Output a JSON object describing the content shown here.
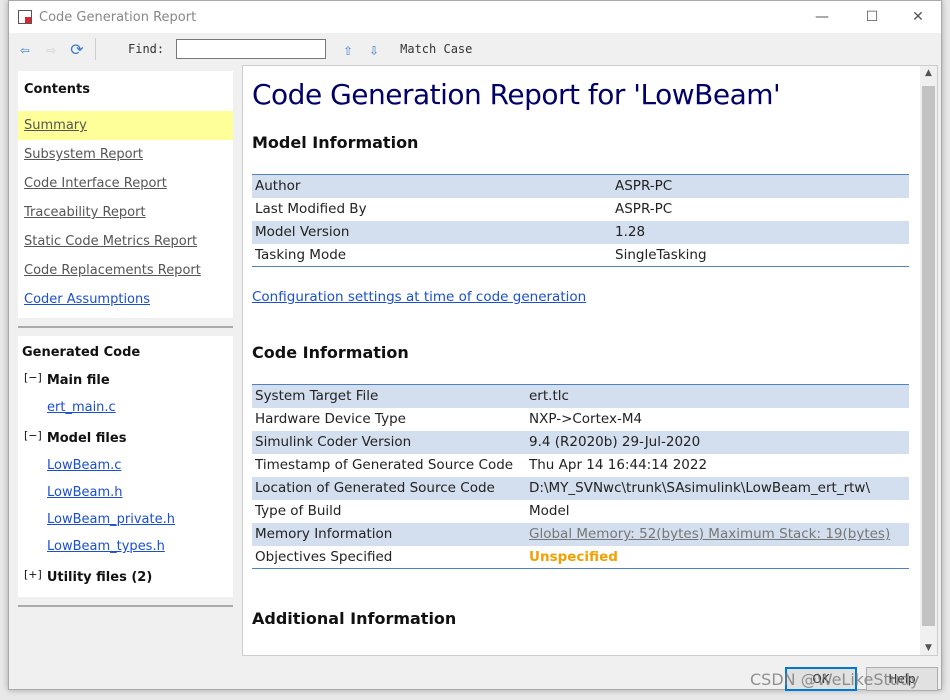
{
  "window": {
    "title": "Code Generation Report",
    "minimize": "—",
    "maximize": "☐",
    "close": "✕"
  },
  "toolbar": {
    "back_icon": "arrow-left",
    "forward_icon": "arrow-right",
    "refresh_icon": "refresh",
    "find_label": "Find:",
    "find_value": "",
    "up_icon": "arrow-up",
    "down_icon": "arrow-down",
    "match_case": "Match Case"
  },
  "sidebar": {
    "contents_title": "Contents",
    "items": [
      {
        "label": "Summary",
        "selected": true
      },
      {
        "label": "Subsystem Report"
      },
      {
        "label": "Code Interface Report"
      },
      {
        "label": "Traceability Report"
      },
      {
        "label": "Static Code Metrics Report"
      },
      {
        "label": "Code Replacements Report"
      },
      {
        "label": "Coder Assumptions"
      }
    ],
    "generated_title": "Generated Code",
    "main_file": {
      "toggle": "[−]",
      "label": "Main file",
      "files": [
        "ert_main.c"
      ]
    },
    "model_files": {
      "toggle": "[−]",
      "label": "Model files",
      "files": [
        "LowBeam.c",
        "LowBeam.h",
        "LowBeam_private.h",
        "LowBeam_types.h"
      ]
    },
    "utility_files": {
      "toggle": "[+]",
      "label": "Utility files (2)"
    }
  },
  "main": {
    "title": "Code Generation Report for 'LowBeam'",
    "model_info_title": "Model Information",
    "model_info": [
      [
        "Author",
        "ASPR-PC"
      ],
      [
        "Last Modified By",
        "ASPR-PC"
      ],
      [
        "Model Version",
        "1.28"
      ],
      [
        "Tasking Mode",
        "SingleTasking"
      ]
    ],
    "config_link": "Configuration settings at time of code generation",
    "code_info_title": "Code Information",
    "code_info": [
      [
        "System Target File",
        "ert.tlc"
      ],
      [
        "Hardware Device Type",
        "NXP->Cortex-M4"
      ],
      [
        "Simulink Coder Version",
        "9.4 (R2020b) 29-Jul-2020"
      ],
      [
        "Timestamp of Generated Source Code",
        "Thu Apr 14 16:44:14 2022"
      ],
      [
        "Location of Generated Source Code",
        "D:\\MY_SVNwc\\trunk\\SAsimulink\\LowBeam_ert_rtw\\"
      ],
      [
        "Type of Build",
        "Model"
      ],
      [
        "Memory Information",
        "Global Memory: 52(bytes) Maximum Stack: 19(bytes)"
      ],
      [
        "Objectives Specified",
        "Unspecified"
      ]
    ],
    "additional_title": "Additional Information"
  },
  "buttons": {
    "ok": "OK",
    "help": "Help"
  },
  "watermark": "CSDN @WeLikeStudy",
  "colors": {
    "title": "#000066",
    "link": "#1a4fd0",
    "row_stripe": "#d3deee",
    "warning": "#f5a000",
    "selected": "#ffff99"
  }
}
